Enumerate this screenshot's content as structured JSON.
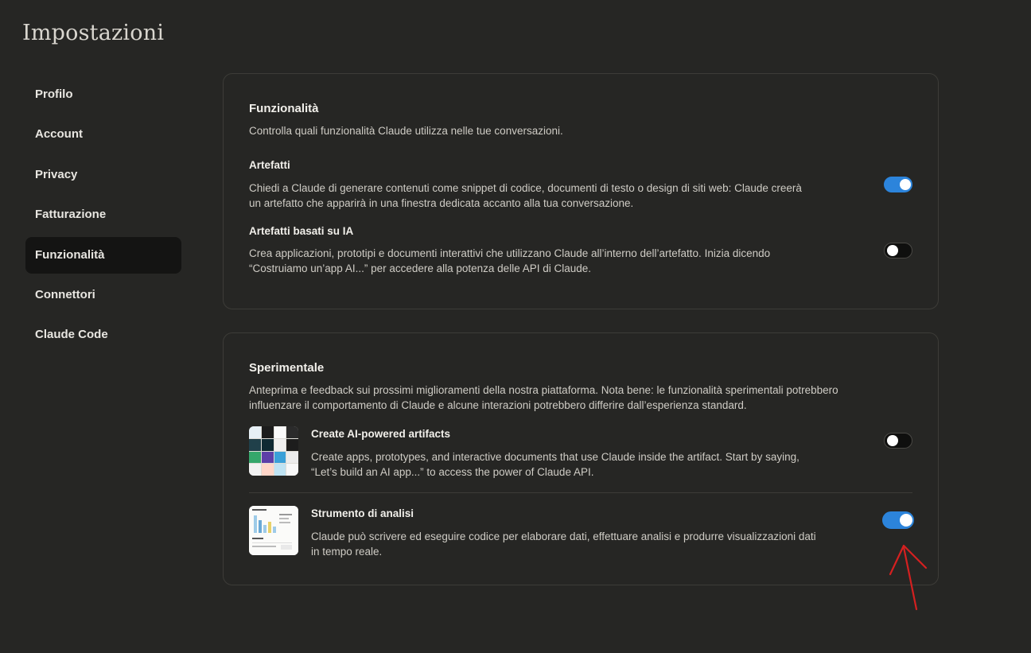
{
  "page": {
    "title": "Impostazioni"
  },
  "sidebar": {
    "items": [
      {
        "label": "Profilo",
        "active": false
      },
      {
        "label": "Account",
        "active": false
      },
      {
        "label": "Privacy",
        "active": false
      },
      {
        "label": "Fatturazione",
        "active": false
      },
      {
        "label": "Funzionalità",
        "active": true
      },
      {
        "label": "Connettori",
        "active": false
      },
      {
        "label": "Claude Code",
        "active": false
      }
    ]
  },
  "features": {
    "title": "Funzionalità",
    "description": "Controlla quali funzionalità Claude utilizza nelle tue conversazioni.",
    "artifacts": {
      "title": "Artefatti",
      "description_1": "Chiedi a Claude di generare contenuti come snippet di codice, documenti di testo o design di siti web: Claude creerà",
      "description_2": "un artefatto che apparirà in una finestra dedicata accanto alla tua conversazione.",
      "enabled": true
    },
    "ai_artifacts": {
      "title": "Artefatti basati su IA",
      "description_1": "Crea applicazioni, prototipi e documenti interattivi che utilizzano Claude all’interno dell’artefatto. Inizia dicendo",
      "description_2": "“Costruiamo un’app AI...” per accedere alla potenza delle API di Claude.",
      "enabled": false
    }
  },
  "experimental": {
    "title": "Sperimentale",
    "description_1": "Anteprima e feedback sui prossimi miglioramenti della nostra piattaforma. Nota bene: le funzionalità sperimentali potrebbero",
    "description_2": "influenzare il comportamento di Claude e alcune interazioni potrebbero differire dall’esperienza standard.",
    "ai_powered": {
      "title": "Create AI-powered artifacts",
      "description_1": "Create apps, prototypes, and interactive documents that use Claude inside the artifact. Start by saying,",
      "description_2": "“Let’s build an AI app...” to access the power of Claude API.",
      "enabled": false
    },
    "analysis": {
      "title": "Strumento di analisi",
      "description_1": "Claude può scrivere ed eseguire codice per elaborare dati, effettuare analisi e produrre visualizzazioni dati",
      "description_2": "in tempo reale.",
      "enabled": true
    }
  },
  "colors": {
    "background": "#262624",
    "toggle_on": "#2c84db",
    "annotation_arrow": "#d42020"
  }
}
